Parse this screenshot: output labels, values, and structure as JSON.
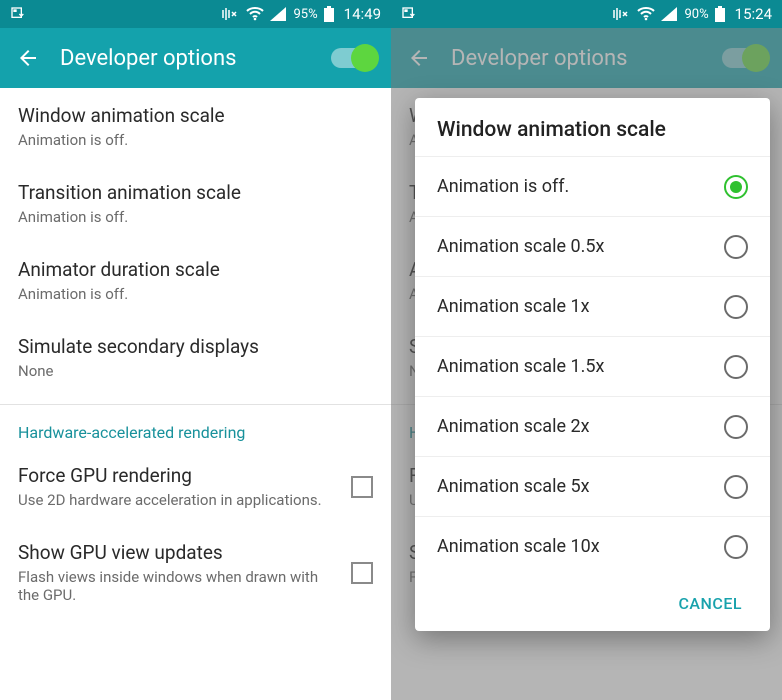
{
  "left": {
    "status": {
      "battery": "95%",
      "time": "14:49"
    },
    "header": {
      "title": "Developer options"
    },
    "items": [
      {
        "title": "Window animation scale",
        "sub": "Animation is off."
      },
      {
        "title": "Transition animation scale",
        "sub": "Animation is off."
      },
      {
        "title": "Animator duration scale",
        "sub": "Animation is off."
      },
      {
        "title": "Simulate secondary displays",
        "sub": "None"
      }
    ],
    "section": "Hardware-accelerated rendering",
    "gpu": [
      {
        "title": "Force GPU rendering",
        "sub": "Use 2D hardware acceleration in applications."
      },
      {
        "title": "Show GPU view updates",
        "sub": "Flash views inside windows when drawn with the GPU."
      }
    ]
  },
  "right": {
    "status": {
      "battery": "90%",
      "time": "15:24"
    },
    "header": {
      "title": "Developer options"
    },
    "bg_items": [
      {
        "title": "W",
        "sub": "Ar"
      },
      {
        "title": "Tr",
        "sub": "Ar"
      },
      {
        "title": "A",
        "sub": "Ar"
      },
      {
        "title": "Si",
        "sub": "Nc"
      }
    ],
    "bg_section": "Ha",
    "bg_gpu": [
      {
        "title": "Fo",
        "sub": "Us"
      },
      {
        "title": "S",
        "sub": "Fla"
      }
    ],
    "dialog": {
      "title": "Window animation scale",
      "options": [
        "Animation is off.",
        "Animation scale 0.5x",
        "Animation scale 1x",
        "Animation scale 1.5x",
        "Animation scale 2x",
        "Animation scale 5x",
        "Animation scale 10x"
      ],
      "selected_index": 0,
      "cancel": "CANCEL"
    }
  }
}
